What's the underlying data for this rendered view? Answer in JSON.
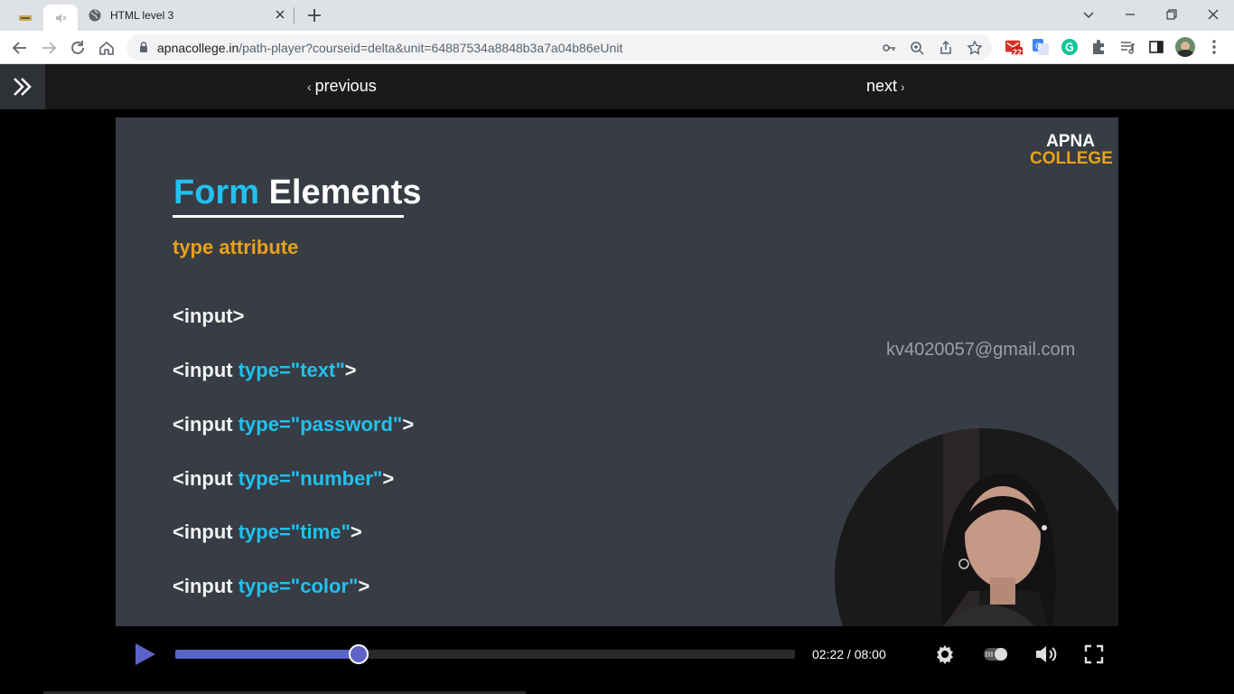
{
  "browser": {
    "tabs": [
      {
        "title": "",
        "icon": "apna-college-favicon"
      },
      {
        "title": "",
        "icon": "muted-speaker-icon"
      },
      {
        "title": "HTML level 3",
        "icon": "globe-icon",
        "active": true
      }
    ],
    "url_host": "apnacollege.in",
    "url_path": "/path-player?courseid=delta&unit=64887534a8848b3a7a04b86eUnit",
    "gmail_badge": "22"
  },
  "site": {
    "prev_label": "previous",
    "next_label": "next"
  },
  "slide": {
    "title_highlight": "Form",
    "title_rest": "Elements",
    "subtitle": "type attribute",
    "logo_line1": "APNA",
    "logo_line2": "COLLEGE",
    "watermark": "kv4020057@gmail.com",
    "code_lines": [
      {
        "pre": "<input>",
        "attr": "",
        "post": ""
      },
      {
        "pre": "<input ",
        "attr": "type=\"text\"",
        "post": ">"
      },
      {
        "pre": "<input ",
        "attr": "type=\"password\"",
        "post": ">"
      },
      {
        "pre": "<input ",
        "attr": "type=\"number\"",
        "post": ">"
      },
      {
        "pre": "<input ",
        "attr": "type=\"time\"",
        "post": ">"
      },
      {
        "pre": "<input ",
        "attr": "type=\"color\"",
        "post": ">"
      }
    ]
  },
  "player": {
    "time_display": "02:22 / 08:00",
    "progress_fraction": 0.296,
    "accent_color": "#5c64c8"
  }
}
